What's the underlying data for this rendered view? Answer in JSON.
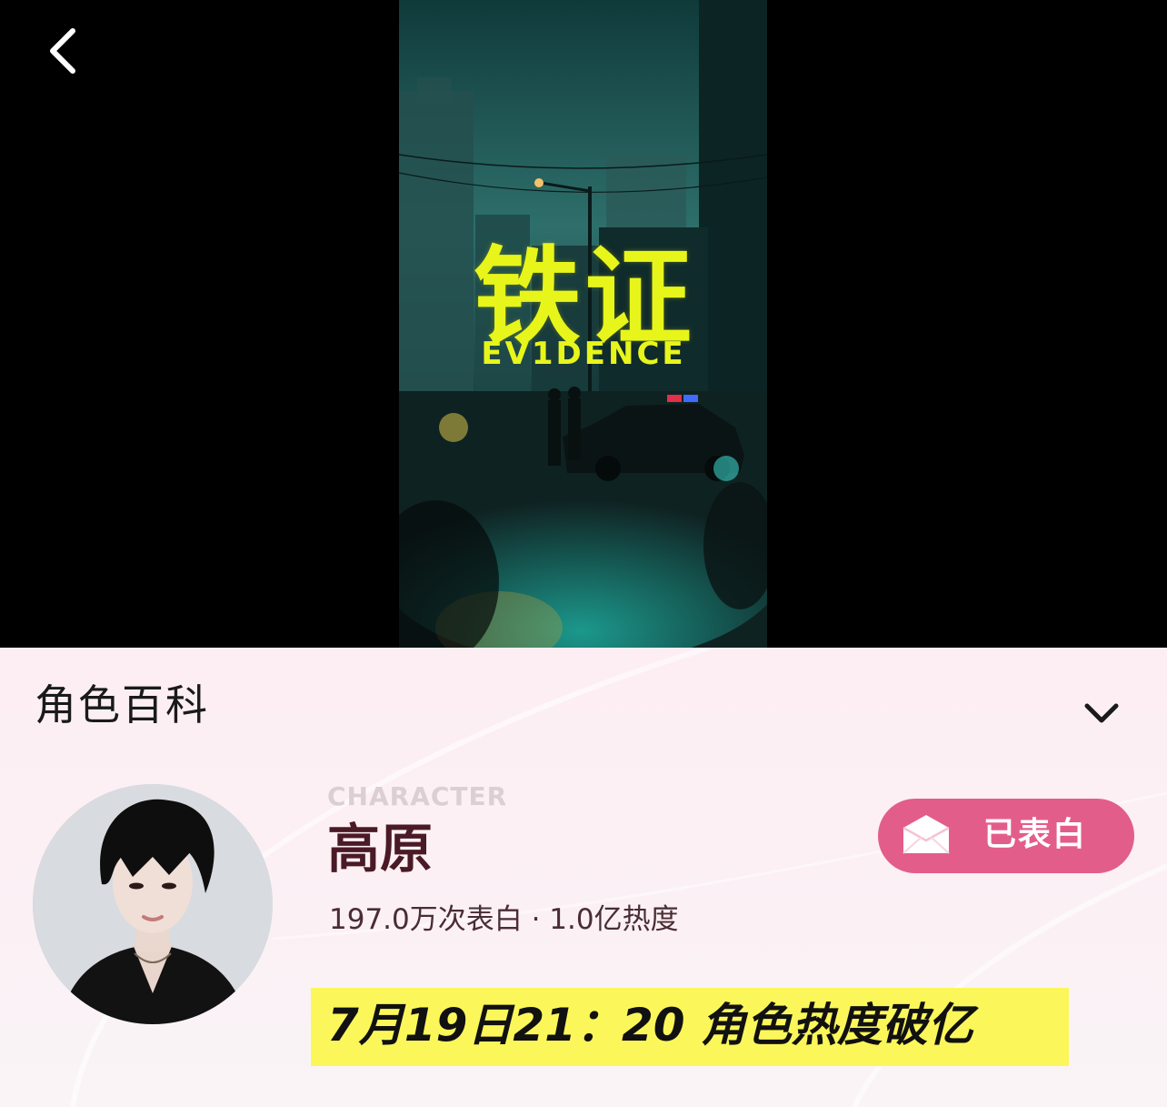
{
  "nav": {
    "back_icon": "chevron-left-icon"
  },
  "poster": {
    "title": "铁证",
    "subtitle": "EV1DENCE"
  },
  "section": {
    "title": "角色百科",
    "toggle_icon": "chevron-down-icon"
  },
  "character": {
    "eyebrow": "CHARACTER",
    "name": "高原",
    "stats": "197.0万次表白 · 1.0亿热度"
  },
  "confess_button": {
    "icon": "envelope-icon",
    "label": "已表白",
    "color": "#e35d8b"
  },
  "milestone": {
    "text": "7月19日21：20 角色热度破亿",
    "highlight_color": "#fbf75a"
  }
}
